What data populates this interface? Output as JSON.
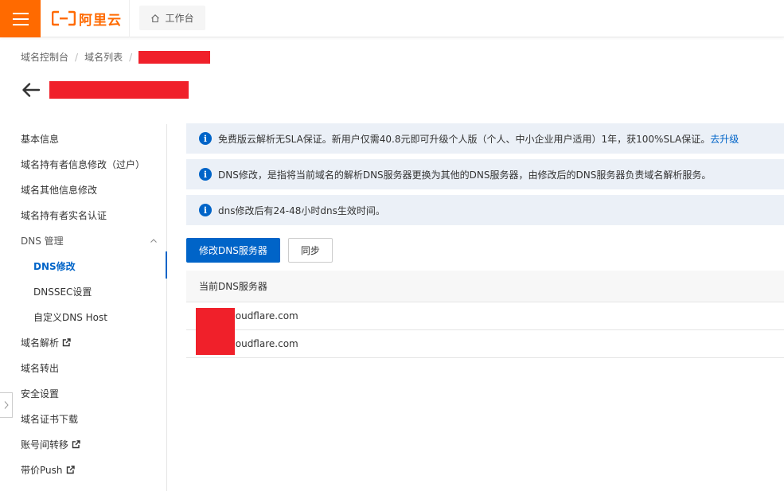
{
  "topbar": {
    "logo_text": "阿里云",
    "workbench_label": "工作台"
  },
  "breadcrumb": {
    "items": [
      "域名控制台",
      "域名列表"
    ]
  },
  "sidebar": {
    "items": [
      {
        "label": "基本信息",
        "external": false
      },
      {
        "label": "域名持有者信息修改（过户）",
        "external": false
      },
      {
        "label": "域名其他信息修改",
        "external": false
      },
      {
        "label": "域名持有者实名认证",
        "external": false
      },
      {
        "label": "DNS 管理",
        "external": false
      },
      {
        "label": "DNS修改",
        "external": false
      },
      {
        "label": "DNSSEC设置",
        "external": false
      },
      {
        "label": "自定义DNS Host",
        "external": false
      },
      {
        "label": "域名解析",
        "external": true
      },
      {
        "label": "域名转出",
        "external": false
      },
      {
        "label": "安全设置",
        "external": false
      },
      {
        "label": "域名证书下载",
        "external": false
      },
      {
        "label": "账号间转移",
        "external": true
      },
      {
        "label": "带价Push",
        "external": true
      }
    ]
  },
  "notices": [
    {
      "text": "免费版云解析无SLA保证。新用户仅需40.8元即可升级个人版（个人、中小企业用户适用）1年，获100%SLA保证。",
      "link": "去升级"
    },
    {
      "text": "DNS修改，是指将当前域名的解析DNS服务器更换为其他的DNS服务器，由修改后的DNS服务器负责域名解析服务。",
      "link": ""
    },
    {
      "text": "dns修改后有24-48小时dns生效时间。",
      "link": ""
    }
  ],
  "buttons": {
    "modify_dns": "修改DNS服务器",
    "sync": "同步"
  },
  "table": {
    "header": "当前DNS服务器",
    "rows": [
      ".cloudflare.com",
      ".cloudflare.com"
    ]
  },
  "colors": {
    "brand": "#ff6a00",
    "primary": "#0064c8",
    "notice_bg": "#ebf0f7",
    "redaction": "#f0202a"
  }
}
